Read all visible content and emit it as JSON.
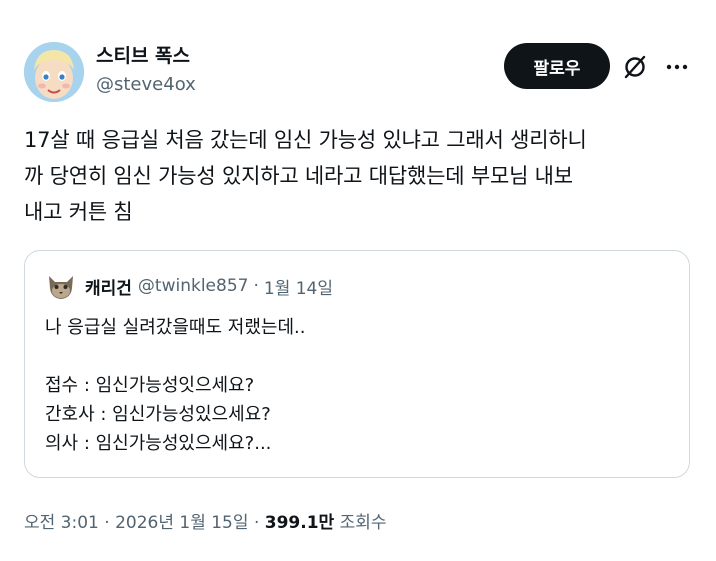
{
  "author": {
    "display_name": "스티브 폭스",
    "handle": "@steve4ox"
  },
  "actions": {
    "follow_label": "팔로우",
    "grok_icon": "grok-icon",
    "more_icon": "more-icon"
  },
  "tweet": {
    "text": "17살 때 응급실 처음 갔는데 임신 가능성 있냐고 그래서 생리하니\n까 당연히 임신 가능성 있지하고 네라고 대답했는데 부모님 내보\n내고 커튼 침"
  },
  "quoted_tweet": {
    "display_name": "캐리건",
    "handle": "@twinkle857",
    "separator": "·",
    "date": "1월 14일",
    "text": "나 응급실 실려갔을때도 저랬는데..\n\n접수 : 임신가능성잇으세요?\n간호사 : 임신가능성있으세요?\n의사 : 임신가능성있으세요?..."
  },
  "meta": {
    "time": "오전 3:01",
    "sep1": "·",
    "date": "2026년 1월 15일",
    "sep2": "·",
    "views_count": "399.1만",
    "views_label": "조회수"
  }
}
